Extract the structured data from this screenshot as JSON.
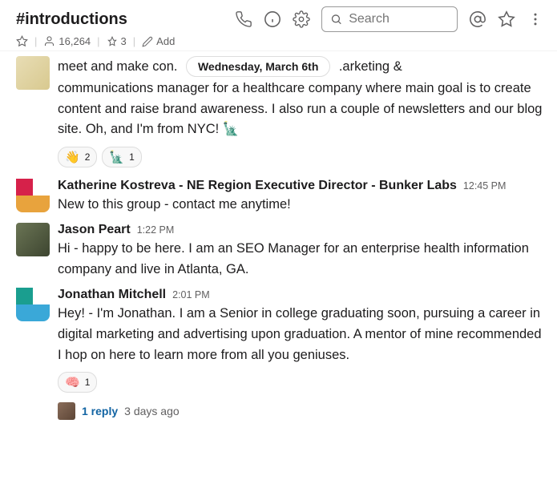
{
  "header": {
    "channel": "#introductions",
    "members": "16,264",
    "pins": "3",
    "add": "Add",
    "search_placeholder": "Search"
  },
  "date": "Wednesday, March 6th",
  "messages": [
    {
      "trunc_before": "meet and make con.",
      "trunc_after": ".arketing &",
      "text": "communications manager for a healthcare company where main goal is to create content and raise brand awareness. I also run a couple of newsletters and our blog site. Oh, and I'm from NYC! 🗽",
      "reactions": [
        {
          "emoji": "👋",
          "count": "2"
        },
        {
          "emoji": "🗽",
          "count": "1"
        }
      ]
    },
    {
      "author": "Katherine Kostreva - NE Region Executive Director - Bunker Labs",
      "time": "12:45 PM",
      "text": "New to this group - contact me anytime!"
    },
    {
      "author": "Jason Peart",
      "time": "1:22 PM",
      "text": "Hi - happy to be here. I am an SEO Manager for an enterprise health information company and live in Atlanta, GA."
    },
    {
      "author": "Jonathan Mitchell",
      "time": "2:01 PM",
      "text": "Hey! - I'm Jonathan.  I am a Senior in college graduating soon, pursuing a career in digital marketing and advertising upon graduation.  A mentor of mine recommended I hop on here to learn more from all you geniuses.",
      "reactions": [
        {
          "emoji": "🧠",
          "count": "1"
        }
      ],
      "thread": {
        "replies": "1 reply",
        "time": "3 days ago"
      }
    }
  ]
}
